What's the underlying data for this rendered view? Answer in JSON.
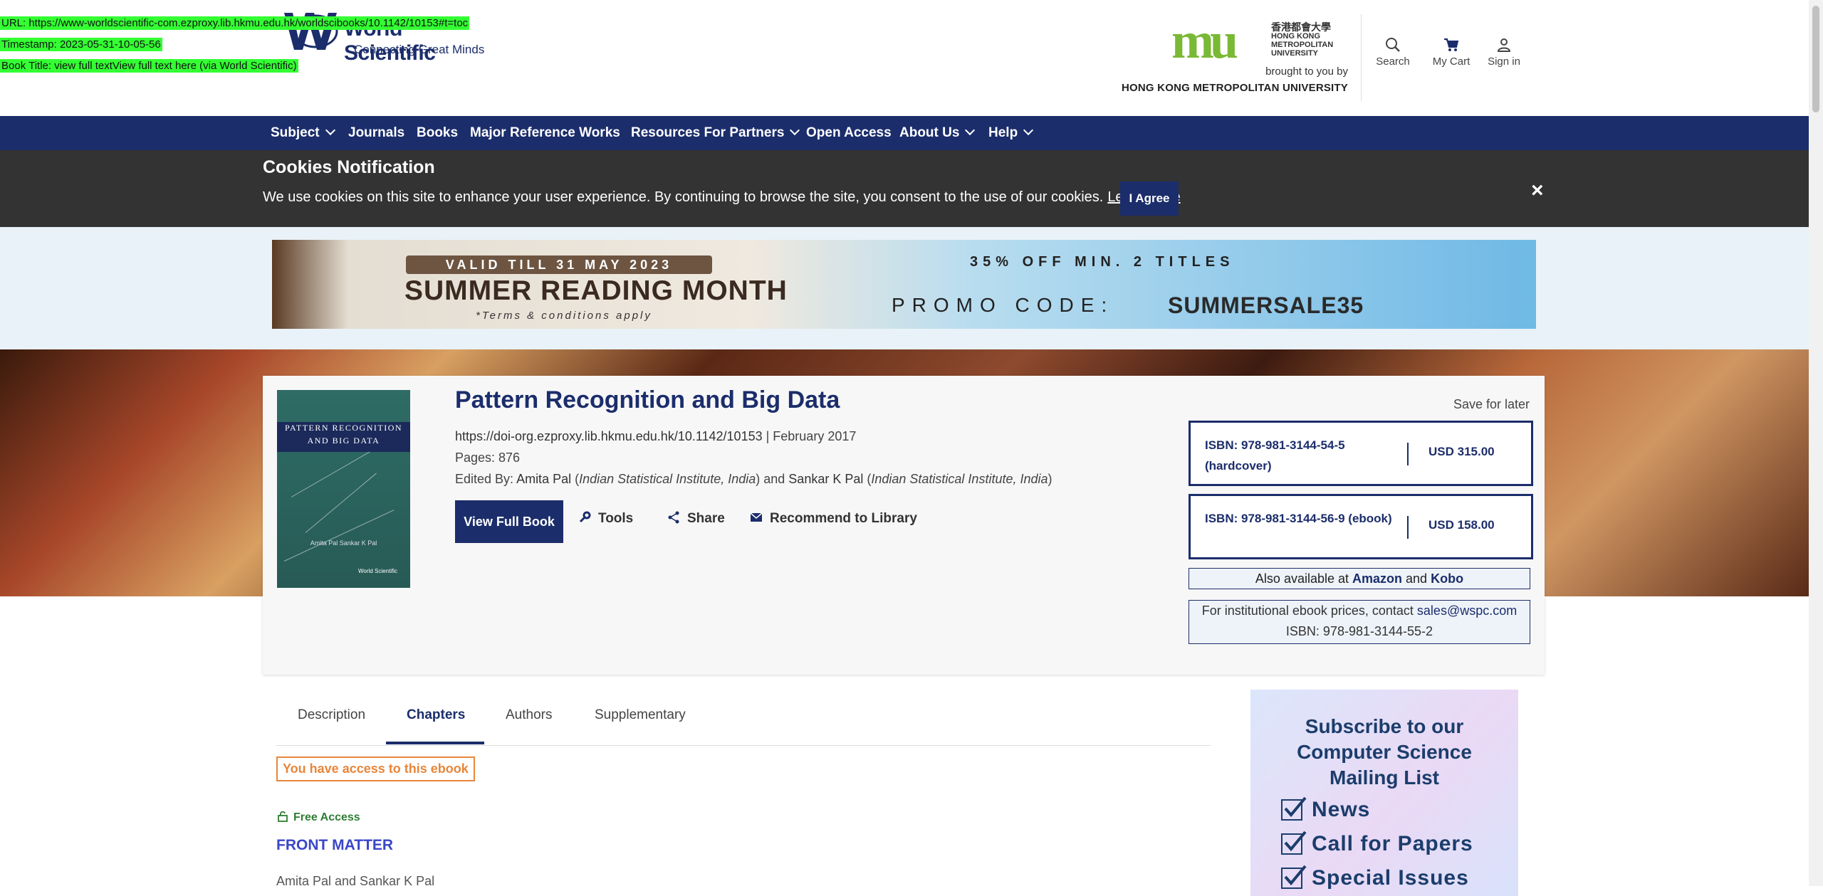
{
  "overlay": {
    "url": "URL: https://www-worldscientific-com.ezproxy.lib.hkmu.edu.hk/worldscibooks/10.1142/10153#t=toc",
    "timestamp": "Timestamp: 2023-05-31-10-05-56",
    "book_title": "Book Title: view full textView full text here (via World Scientific)"
  },
  "header": {
    "logo_name": "World Scientific",
    "logo_tagline": "Connecting Great Minds",
    "uni_logo_mark": "mu",
    "uni_logo_zh": "香港都會大學",
    "uni_logo_en": "HONG KONG METROPOLITAN UNIVERSITY",
    "brought_by": "brought to you by",
    "university": "HONG KONG METROPOLITAN UNIVERSITY",
    "search_label": "Search",
    "cart_label": "My Cart",
    "signin_label": "Sign in"
  },
  "nav": {
    "subject": "Subject",
    "journals": "Journals",
    "books": "Books",
    "mrw": "Major Reference Works",
    "partners": "Resources For Partners",
    "open_access": "Open Access",
    "about": "About Us",
    "help": "Help"
  },
  "cookies": {
    "title": "Cookies Notification",
    "message": "We use cookies on this site to enhance your user experience. By continuing to browse the site, you consent to the use of our cookies.",
    "learn_more": "Learn More",
    "agree": "I Agree",
    "close": "×"
  },
  "promo": {
    "valid": "VALID TILL 31 MAY 2023",
    "headline": "SUMMER READING MONTH",
    "terms": "*Terms & conditions apply",
    "offer": "35% OFF MIN. 2 TITLES",
    "promo_label": "PROMO CODE:",
    "code": "SUMMERSALE35"
  },
  "book": {
    "cover_line1": "PATTERN RECOGNITION",
    "cover_line2": "AND BIG DATA",
    "cover_authors": "Amita Pal    Sankar K Pal",
    "cover_publisher": "World Scientific",
    "title": "Pattern Recognition and Big Data",
    "doi": "https://doi-org.ezproxy.lib.hkmu.edu.hk/10.1142/10153",
    "date": " | February 2017",
    "pages": "Pages: 876",
    "edited_by": "Edited By: ",
    "editor1": "Amita Pal",
    "editor1_affil": "Indian Statistical Institute, India",
    "and": " and ",
    "editor2": "Sankar K Pal",
    "editor2_affil": "Indian Statistical Institute, India",
    "view_full": "View Full Book",
    "tools": "Tools",
    "share": "Share",
    "recommend": "Recommend to Library"
  },
  "purchase": {
    "save_later": "Save for later",
    "hardcover_isbn": "ISBN: 978-981-3144-54-5 (hardcover)",
    "hardcover_price": "USD 315.00",
    "ebook_isbn": "ISBN: 978-981-3144-56-9 (ebook)",
    "ebook_price": "USD 158.00",
    "also_available": "Also available at ",
    "amazon": "Amazon",
    "and": " and ",
    "kobo": "Kobo",
    "institutional": "For institutional ebook prices, contact ",
    "email": "sales@wspc.com",
    "inst_isbn": "ISBN: 978-981-3144-55-2"
  },
  "tabs": {
    "description": "Description",
    "chapters": "Chapters",
    "authors": "Authors",
    "supplementary": "Supplementary"
  },
  "chapters": {
    "access": "You have access to this ebook",
    "free_access": "Free Access",
    "front_matter": "FRONT MATTER",
    "front_authors": "Amita Pal and Sankar K Pal"
  },
  "ad": {
    "line1": "Subscribe to our",
    "line2": "Computer Science",
    "line3": "Mailing List",
    "item1": "News",
    "item2": "Call for Papers",
    "item3": "Special Issues"
  }
}
